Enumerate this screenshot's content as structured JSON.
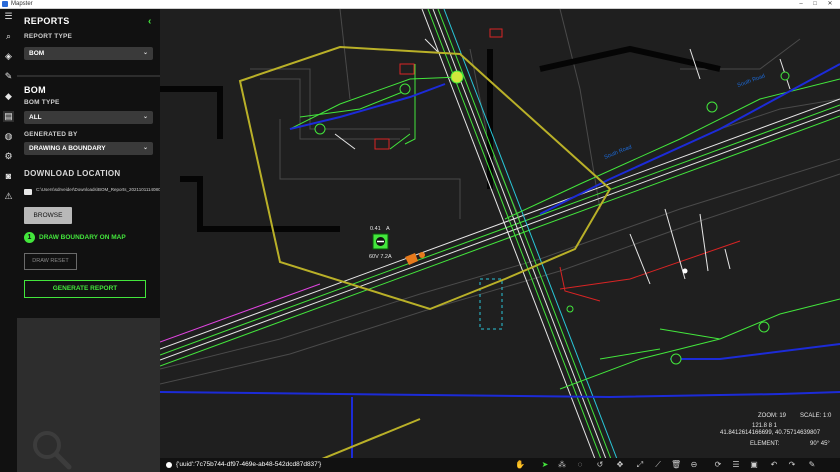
{
  "window": {
    "title": "Mapster",
    "controls": {
      "minimize": "–",
      "maximize": "□",
      "close": "✕"
    }
  },
  "iconbar": {
    "items": [
      {
        "name": "menu-icon",
        "glyph": "☰"
      },
      {
        "name": "search-icon",
        "glyph": "⌕"
      },
      {
        "name": "layers-box-icon",
        "glyph": "◈"
      },
      {
        "name": "edit-icon",
        "glyph": "✎"
      },
      {
        "name": "layers-icon",
        "glyph": "◆"
      },
      {
        "name": "reports-icon",
        "glyph": "▤"
      },
      {
        "name": "globe-icon",
        "glyph": "◍"
      },
      {
        "name": "settings-icon",
        "glyph": "⚙"
      },
      {
        "name": "camera-icon",
        "glyph": "◙"
      },
      {
        "name": "alert-icon",
        "glyph": "⚠"
      }
    ]
  },
  "panel": {
    "title": "REPORTS",
    "collapse_icon": "‹",
    "report_type_label": "REPORT TYPE",
    "report_type_value": "BOM",
    "bom_title": "BOM",
    "bom_type_label": "BOM TYPE",
    "bom_type_value": "ALL",
    "generated_by_label": "GENERATED BY",
    "generated_by_value": "DRAWING A BOUNDARY",
    "download_title": "DOWNLOAD LOCATION",
    "download_path": "C:\\Users\\sdrveider\\Downloads\\BOM_Reports_20211011140802",
    "browse_label": "BROWSE",
    "draw_step_number": "1",
    "draw_boundary_label": "DRAW BOUNDARY ON MAP",
    "draw_reset_label": "DRAW RESET",
    "generate_label": "GENERATE REPORT"
  },
  "map": {
    "selected_label_top": "0.41",
    "selected_label_top_right": "A",
    "selected_label_bottom": "60V 7.2A",
    "road_label_1": "South Road",
    "road_label_2": "South Road",
    "colors": {
      "background": "#1f1f1f",
      "boundary": "#b9b028",
      "primary": "#43e63c",
      "blue": "#1c2bd8",
      "red": "#d82424",
      "white": "#e6e6e6",
      "magenta": "#e044e0",
      "cyan": "#29c6d8"
    }
  },
  "status": {
    "uuid_text": "{'uuid':'7c75b744-df97-469e-ab48-542dcd87d837'}",
    "zoom_label": "ZOOM: 19",
    "scale_label": "SCALE: 1:0",
    "coords_line1": "121.8 8 1",
    "coords_line2": "41.8412614166699, 40.75714639807",
    "element_label": "ELEMENT:",
    "angles": "90°  45°"
  }
}
